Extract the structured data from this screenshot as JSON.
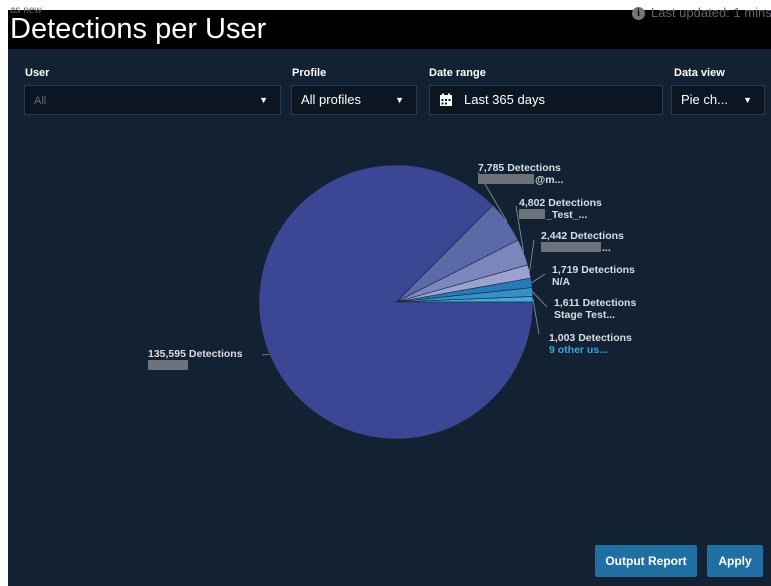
{
  "header": {
    "ghost_label": "as new",
    "title": "Detections per User",
    "updated_text": "Last updated: 1 mins"
  },
  "filters": {
    "user": {
      "label": "User",
      "value": "All"
    },
    "profile": {
      "label": "Profile",
      "value": "All profiles"
    },
    "date_range": {
      "label": "Date range",
      "value": "Last 365 days"
    },
    "data_view": {
      "label": "Data view",
      "value": "Pie ch..."
    }
  },
  "buttons": {
    "output_report": "Output Report",
    "apply": "Apply"
  },
  "colors": {
    "panel_bg": "#132232",
    "accent": "#1f6fa3",
    "link": "#38a3e0"
  },
  "chart_data": {
    "type": "pie",
    "slices": [
      {
        "value": 135595,
        "value_label": "135,595 Detections",
        "name_label": "",
        "color": "#3b4795"
      },
      {
        "value": 7785,
        "value_label": "7,785 Detections",
        "name_label": "@m...",
        "color": "#5c69a9"
      },
      {
        "value": 4802,
        "value_label": "4,802 Detections",
        "name_label": "_Test_...",
        "color": "#7b86bd"
      },
      {
        "value": 2442,
        "value_label": "2,442 Detections",
        "name_label": "...",
        "color": "#9aa3cf"
      },
      {
        "value": 1719,
        "value_label": "1,719 Detections",
        "name_label": "N/A",
        "color": "#2979b8"
      },
      {
        "value": 1611,
        "value_label": "1,611 Detections",
        "name_label": "Stage Test...",
        "color": "#3390c9"
      },
      {
        "value": 1003,
        "value_label": "1,003 Detections",
        "name_label": "9 other us...",
        "color": "#46a8de"
      }
    ]
  }
}
